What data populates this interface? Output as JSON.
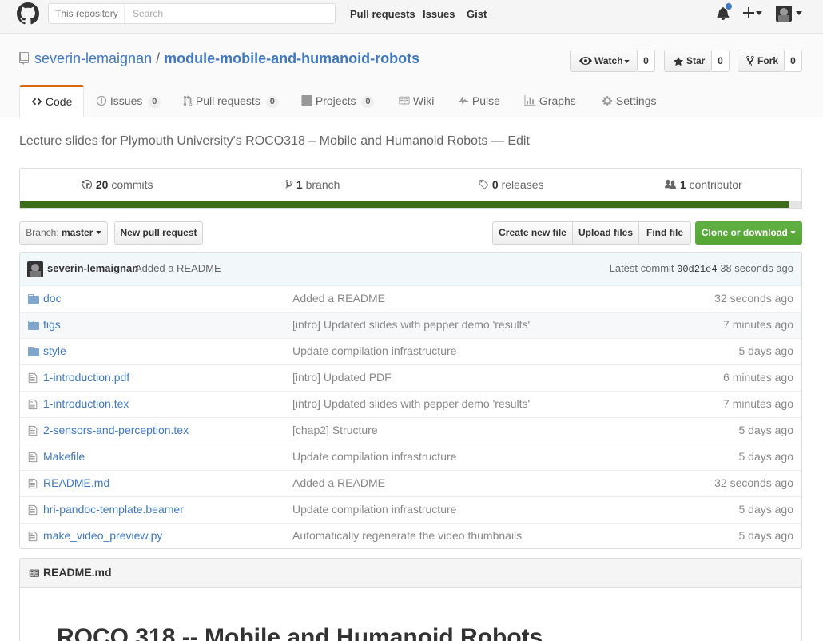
{
  "header": {
    "search_scope": "This repository",
    "search_placeholder": "Search",
    "nav": [
      "Pull requests",
      "Issues",
      "Gist"
    ],
    "accent": "#4078c0"
  },
  "repo": {
    "owner": "severin-lemaignan",
    "separator": "/",
    "name": "module-mobile-and-humanoid-robots",
    "watch_label": "Watch",
    "watch_count": "0",
    "star_label": "Star",
    "star_count": "0",
    "fork_label": "Fork",
    "fork_count": "0"
  },
  "tabs": [
    {
      "label": "Code",
      "icon": "code-icon"
    },
    {
      "label": "Issues",
      "count": "0",
      "icon": "issue-icon"
    },
    {
      "label": "Pull requests",
      "count": "0",
      "icon": "pull-request-icon"
    },
    {
      "label": "Projects",
      "count": "0",
      "icon": "project-icon"
    },
    {
      "label": "Wiki",
      "icon": "book-icon"
    },
    {
      "label": "Pulse",
      "icon": "pulse-icon"
    },
    {
      "label": "Graphs",
      "icon": "graph-icon"
    },
    {
      "label": "Settings",
      "icon": "gear-icon"
    }
  ],
  "description": {
    "text": "Lecture slides for Plymouth University's ROCO318 – Mobile and Humanoid Robots",
    "dash": "—",
    "edit": "Edit"
  },
  "summary": {
    "commits_num": "20",
    "commits_label": "commits",
    "branch_num": "1",
    "branch_label": "branch",
    "releases_num": "0",
    "releases_label": "releases",
    "contributors_num": "1",
    "contributors_label": "contributor",
    "language_fraction": 0.984,
    "language_color": "#3c6c1c"
  },
  "file_nav": {
    "branch_prefix": "Branch:",
    "branch_name": "master",
    "new_pr": "New pull request",
    "create_file": "Create new file",
    "upload": "Upload files",
    "find": "Find file",
    "clone": "Clone or download"
  },
  "commit_tease": {
    "author": "severin-lemaignan",
    "message": "Added a README",
    "latest_label": "Latest commit",
    "sha": "00d21e4",
    "age": "38 seconds ago"
  },
  "files": [
    {
      "name": "doc",
      "type": "dir",
      "message": "Added a README",
      "age": "32 seconds ago"
    },
    {
      "name": "figs",
      "type": "dir",
      "message": "[intro] Updated slides with pepper demo 'results'",
      "age": "7 minutes ago"
    },
    {
      "name": "style",
      "type": "dir",
      "message": "Update compilation infrastructure",
      "age": "5 days ago"
    },
    {
      "name": "1-introduction.pdf",
      "type": "file",
      "message": "[intro] Updated PDF",
      "age": "6 minutes ago"
    },
    {
      "name": "1-introduction.tex",
      "type": "file",
      "message": "[intro] Updated slides with pepper demo 'results'",
      "age": "7 minutes ago"
    },
    {
      "name": "2-sensors-and-perception.tex",
      "type": "file",
      "message": "[chap2] Structure",
      "age": "5 days ago"
    },
    {
      "name": "Makefile",
      "type": "file",
      "message": "Update compilation infrastructure",
      "age": "5 days ago"
    },
    {
      "name": "README.md",
      "type": "file",
      "message": "Added a README",
      "age": "32 seconds ago"
    },
    {
      "name": "hri-pandoc-template.beamer",
      "type": "file",
      "message": "Update compilation infrastructure",
      "age": "5 days ago"
    },
    {
      "name": "make_video_preview.py",
      "type": "file",
      "message": "Automatically regenerate the video thumbnails",
      "age": "5 days ago"
    }
  ],
  "readme": {
    "filename": "README.md",
    "heading": "ROCO 318 -- Mobile and Humanoid Robots"
  }
}
